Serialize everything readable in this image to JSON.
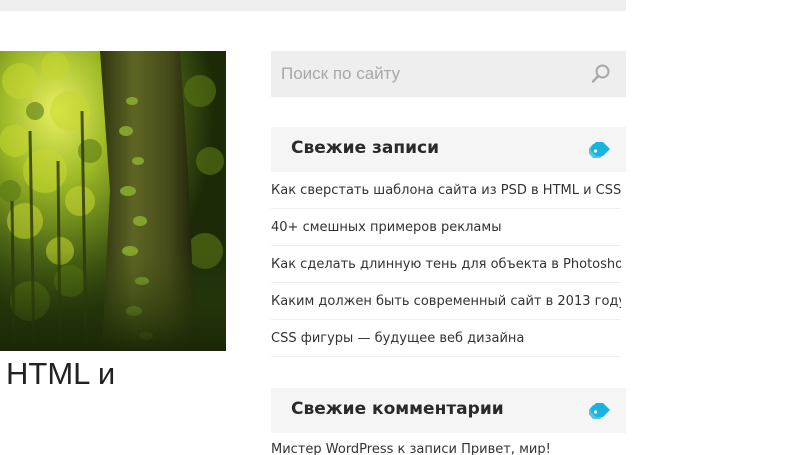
{
  "featured_image": {
    "alt": "Лес"
  },
  "post": {
    "title_fragment": "HTML и"
  },
  "search": {
    "placeholder": "Поиск по сайту",
    "icon": "search-icon"
  },
  "recent_posts": {
    "title": "Свежие записи",
    "icon": "tag-icon",
    "items": [
      "Как сверстать шаблона сайта из PSD в HTML и CSS",
      "40+ смешных примеров рекламы",
      "Как сделать длинную тень для объекта в Photoshop",
      "Каким должен быть современный сайт в 2013 году",
      "CSS фигуры — будущее веб дизайна"
    ]
  },
  "recent_comments": {
    "title": "Свежие комментарии",
    "icon": "tag-icon",
    "items": [
      {
        "author": "Мистер WordPress",
        "connector": " к записи ",
        "post": "Привет, мир!"
      }
    ]
  },
  "colors": {
    "accent": "#1ab3e0",
    "header_bg": "#f5f5f5",
    "search_bg": "#eeeeee"
  }
}
